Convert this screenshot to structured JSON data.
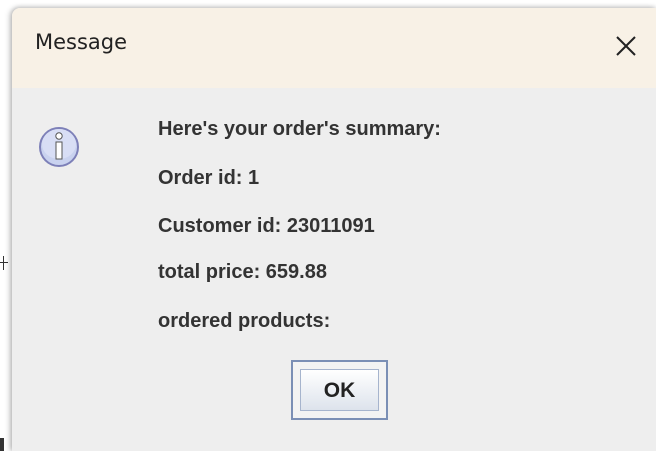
{
  "dialog": {
    "title": "Message",
    "icon": "info-icon",
    "close_icon": "close-icon",
    "lines": [
      "Here's your order's summary:",
      "Order id: 1",
      "Customer id: 23011091",
      "total price: 659.88",
      "ordered products:"
    ],
    "ok_label": "OK"
  },
  "colors": {
    "title_bar": "#f8f1e6",
    "body": "#eeeeee",
    "text": "#333333",
    "button_border": "#7b8fb5",
    "icon_fill": "#c9d2ef"
  }
}
